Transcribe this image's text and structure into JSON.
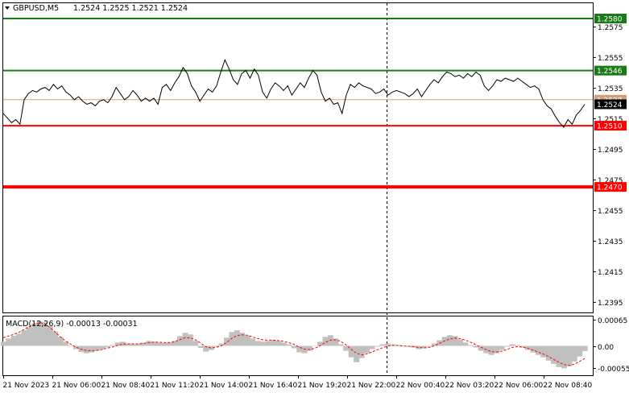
{
  "header": {
    "symbol": "GBPUSD,M5",
    "ohlc": "1.2524 1.2525 1.2521 1.2524"
  },
  "colors": {
    "price_line": "#000000",
    "resistance": "#1a7a1a",
    "support": "#ff0000",
    "bid_line": "#d2a078",
    "current_price_bg": "#000000",
    "macd_hist": "#c0c0c0",
    "macd_signal": "#ff0000"
  },
  "chart_data": [
    {
      "type": "line",
      "title": "GBPUSD,M5",
      "ylim": [
        1.2388,
        1.259
      ],
      "y_ticks": [
        "1.2575",
        "1.2555",
        "1.2535",
        "1.2515",
        "1.2495",
        "1.2475",
        "1.2455",
        "1.2435",
        "1.2415",
        "1.2395"
      ],
      "x_ticks": [
        "21 Nov 2023",
        "21 Nov 06:00",
        "21 Nov 08:40",
        "21 Nov 11:20",
        "21 Nov 14:00",
        "21 Nov 16:40",
        "21 Nov 19:20",
        "21 Nov 22:00",
        "22 Nov 00:40",
        "22 Nov 03:20",
        "22 Nov 06:00",
        "22 Nov 08:40"
      ],
      "series": [
        {
          "values": [
            1.2518,
            1.2515,
            1.2512,
            1.2514,
            1.2511,
            1.2527,
            1.2531,
            1.2533,
            1.2532,
            1.2534,
            1.2535,
            1.2533,
            1.2537,
            1.2534,
            1.2536,
            1.2532,
            1.253,
            1.2527,
            1.2529,
            1.2526,
            1.2524,
            1.2525,
            1.2523,
            1.2526,
            1.2527,
            1.2525,
            1.2529,
            1.2535,
            1.2531,
            1.2527,
            1.2529,
            1.2533,
            1.253,
            1.2526,
            1.2528,
            1.2526,
            1.2528,
            1.2524,
            1.2535,
            1.2537,
            1.2533,
            1.2538,
            1.2542,
            1.2548,
            1.2544,
            1.2536,
            1.2532,
            1.2526,
            1.253,
            1.2534,
            1.2532,
            1.2536,
            1.2545,
            1.2553,
            1.2547,
            1.254,
            1.2537,
            1.2544,
            1.2546,
            1.2541,
            1.2547,
            1.2543,
            1.2532,
            1.2528,
            1.2534,
            1.2538,
            1.2536,
            1.2533,
            1.2536,
            1.253,
            1.2534,
            1.2538,
            1.2535,
            1.2541,
            1.2546,
            1.2543,
            1.2532,
            1.2526,
            1.2528,
            1.2524,
            1.2525,
            1.2518,
            1.253,
            1.2537,
            1.2535,
            1.2538,
            1.2536,
            1.2535,
            1.2534,
            1.2531,
            1.2532,
            1.2534,
            1.253,
            1.2532,
            1.2533,
            1.2532,
            1.2531,
            1.2529,
            1.2531,
            1.2534,
            1.2529,
            1.2533,
            1.2537,
            1.254,
            1.2538,
            1.2542,
            1.2545,
            1.2544,
            1.2542,
            1.2543,
            1.2541,
            1.2544,
            1.2542,
            1.2545,
            1.2543,
            1.2536,
            1.2533,
            1.2536,
            1.254,
            1.2539,
            1.2541,
            1.254,
            1.2539,
            1.2541,
            1.2539,
            1.2537,
            1.2535,
            1.2536,
            1.2534,
            1.2527,
            1.2523,
            1.2521,
            1.2516,
            1.2512,
            1.2509,
            1.2514,
            1.2511,
            1.2517,
            1.252,
            1.2524
          ],
          "color": "#000000"
        }
      ],
      "levels": [
        {
          "label": "1.2580",
          "value": 1.258,
          "color": "#1a7a1a"
        },
        {
          "label": "1.2546",
          "value": 1.2546,
          "color": "#1a7a1a"
        },
        {
          "label": "1.2527",
          "value": 1.2527,
          "color": "#d2a078"
        },
        {
          "label": "1.2524",
          "value": 1.2524,
          "color": "#000000"
        },
        {
          "label": "1.2510",
          "value": 1.251,
          "color": "#ff0000"
        },
        {
          "label": "1.2470",
          "value": 1.247,
          "color": "#ff0000"
        }
      ]
    },
    {
      "type": "bar",
      "title": "MACD(12,26,9) -0.00013 -0.00031",
      "ylim": [
        -0.00072,
        0.00072
      ],
      "y_ticks": [
        "0.00065",
        "0.00",
        "-0.00055"
      ],
      "series": [
        {
          "name": "MACD",
          "type": "bar",
          "color": "#c0c0c0",
          "values": [
            0.0001,
            0.00018,
            0.00025,
            0.0003,
            0.00038,
            0.00046,
            0.00055,
            0.0006,
            0.00058,
            0.00048,
            0.00035,
            0.00022,
            0.0001,
            0.0,
            -8e-05,
            -0.00015,
            -0.00018,
            -0.00016,
            -0.00012,
            -8e-05,
            -4e-05,
            2e-05,
            8e-05,
            0.0001,
            6e-05,
            4e-05,
            5e-05,
            8e-05,
            0.00012,
            0.0001,
            8e-05,
            7e-05,
            8e-05,
            0.00012,
            0.00024,
            0.00032,
            0.00028,
            0.00012,
            -5e-05,
            -0.00014,
            -0.0001,
            -2e-05,
            6e-05,
            0.0002,
            0.00034,
            0.00038,
            0.00032,
            0.00025,
            0.00018,
            0.00012,
            0.0001,
            0.00012,
            0.00015,
            0.00012,
            8e-05,
            4e-05,
            -6e-05,
            -0.00016,
            -0.00018,
            -0.00012,
            0.0,
            0.0001,
            0.00022,
            0.00026,
            0.00018,
            4e-05,
            -0.00012,
            -0.00028,
            -0.0004,
            -0.0003,
            -0.00018,
            -8e-05,
            -2e-05,
            4e-05,
            6e-05,
            4e-05,
            2e-05,
            0.0,
            -2e-05,
            -4e-05,
            -8e-05,
            -6e-05,
            -2e-05,
            6e-05,
            0.00014,
            0.00022,
            0.00026,
            0.00024,
            0.00016,
            8e-05,
            2e-05,
            -4e-05,
            -0.00012,
            -0.00018,
            -0.00022,
            -0.00018,
            -0.0001,
            -2e-05,
            4e-05,
            2e-05,
            -4e-05,
            -0.0001,
            -0.00016,
            -0.00022,
            -0.00028,
            -0.00036,
            -0.00044,
            -0.00052,
            -0.00055,
            -0.0005,
            -0.00038,
            -0.00026,
            -0.00013
          ]
        },
        {
          "name": "Signal",
          "type": "line",
          "color": "#ff0000",
          "values": [
            0.0002,
            0.00024,
            0.00028,
            0.00033,
            0.0004,
            0.00047,
            0.00053,
            0.00057,
            0.00054,
            0.00045,
            0.00034,
            0.00022,
            0.00012,
            4e-05,
            -3e-05,
            -8e-05,
            -0.00011,
            -0.00012,
            -0.00011,
            -9e-05,
            -6e-05,
            -3e-05,
            1e-05,
            4e-05,
            5e-05,
            5e-05,
            5e-05,
            6e-05,
            8e-05,
            9e-05,
            9e-05,
            8e-05,
            8e-05,
            0.0001,
            0.00015,
            0.0002,
            0.0002,
            0.00015,
            7e-05,
            -2e-05,
            -5e-05,
            -4e-05,
            0.0,
            8e-05,
            0.00018,
            0.00025,
            0.00027,
            0.00026,
            0.00022,
            0.00018,
            0.00015,
            0.00014,
            0.00014,
            0.00013,
            0.00011,
            8e-05,
            4e-05,
            -3e-05,
            -8e-05,
            -9e-05,
            -6e-05,
            0.0,
            8e-05,
            0.00014,
            0.00015,
            0.00011,
            3e-05,
            -8e-05,
            -0.00018,
            -0.00022,
            -0.0002,
            -0.00015,
            -0.0001,
            -5e-05,
            -1e-05,
            1e-05,
            1e-05,
            0.0,
            -1e-05,
            -2e-05,
            -4e-05,
            -5e-05,
            -4e-05,
            0.0,
            6e-05,
            0.00012,
            0.00017,
            0.00019,
            0.00018,
            0.00014,
            9e-05,
            3e-05,
            -3e-05,
            -9e-05,
            -0.00014,
            -0.00015,
            -0.00013,
            -9e-05,
            -4e-05,
            -2e-05,
            -3e-05,
            -6e-05,
            -0.0001,
            -0.00015,
            -0.0002,
            -0.00026,
            -0.00033,
            -0.0004,
            -0.00046,
            -0.00048,
            -0.00045,
            -0.00038,
            -0.00031
          ]
        }
      ]
    }
  ]
}
